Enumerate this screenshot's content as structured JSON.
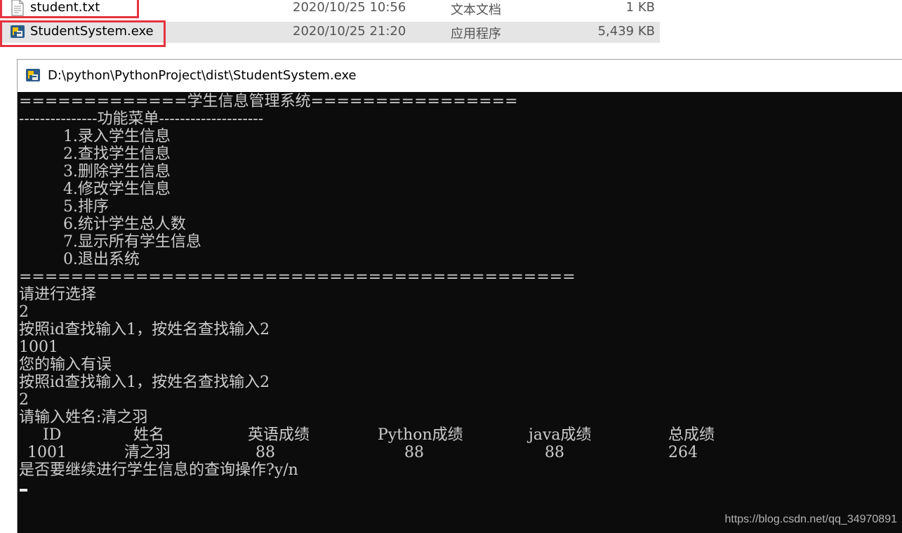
{
  "explorer": {
    "files": [
      {
        "name": "student.txt",
        "date": "2020/10/25 10:56",
        "type": "文本文档",
        "size": "1 KB",
        "icon": "text-file-icon"
      },
      {
        "name": "StudentSystem.exe",
        "date": "2020/10/25 21:20",
        "type": "应用程序",
        "size": "5,439 KB",
        "icon": "python-exe-icon"
      }
    ],
    "highlight_color": "#e5333f"
  },
  "console": {
    "title": "D:\\python\\PythonProject\\dist\\StudentSystem.exe",
    "background": "#0c0c0c",
    "text_color": "#cccccc",
    "lines_top": [
      "=============学生信息管理系统================",
      "---------------功能菜单--------------------",
      "         1.录入学生信息",
      "         2.查找学生信息",
      "         3.删除学生信息",
      "         4.修改学生信息",
      "         5.排序",
      "         6.统计学生总人数",
      "         7.显示所有学生信息",
      "         0.退出系统",
      "===========================================",
      "请进行选择",
      "2",
      "按照id查找输入1，按姓名查找输入2",
      "1001",
      "您的输入有误",
      "按照id查找输入1，按姓名查找输入2",
      "2",
      "请输入姓名:清之羽"
    ],
    "table": {
      "headers": [
        "ID",
        "姓名",
        "英语成绩",
        "Python成绩",
        "java成绩",
        "总成绩"
      ],
      "row": [
        "1001",
        "清之羽",
        "88",
        "88",
        "88",
        "264"
      ]
    },
    "prompt": "是否要继续进行学生信息的查询操作?y/n"
  },
  "watermark": "https://blog.csdn.net/qq_34970891"
}
